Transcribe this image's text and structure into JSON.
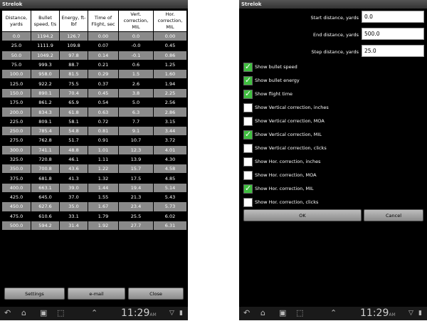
{
  "app_title": "Strelok",
  "table": {
    "headers": [
      "Distance, yards",
      "Bullet speed, f/s",
      "Energy, ft-lbf",
      "Time of Flight, sec",
      "Vert. correction, MIL",
      "Hor. correction, MIL"
    ],
    "rows": [
      [
        "0.0",
        "1194.2",
        "126.7",
        "0.00",
        "0.0",
        "0.00"
      ],
      [
        "25.0",
        "1111.9",
        "109.8",
        "0.07",
        "-0.0",
        "0.45"
      ],
      [
        "50.0",
        "1049.2",
        "97.8",
        "0.14",
        "-0.1",
        "0.86"
      ],
      [
        "75.0",
        "999.3",
        "88.7",
        "0.21",
        "0.6",
        "1.25"
      ],
      [
        "100.0",
        "958.0",
        "81.5",
        "0.29",
        "1.5",
        "1.60"
      ],
      [
        "125.0",
        "922.2",
        "75.5",
        "0.37",
        "2.6",
        "1.94"
      ],
      [
        "150.0",
        "890.1",
        "70.4",
        "0.45",
        "3.8",
        "2.25"
      ],
      [
        "175.0",
        "861.2",
        "65.9",
        "0.54",
        "5.0",
        "2.56"
      ],
      [
        "200.0",
        "834.3",
        "61.8",
        "0.63",
        "6.3",
        "2.86"
      ],
      [
        "225.0",
        "809.1",
        "58.1",
        "0.72",
        "7.7",
        "3.15"
      ],
      [
        "250.0",
        "785.4",
        "54.8",
        "0.81",
        "9.1",
        "3.44"
      ],
      [
        "275.0",
        "762.8",
        "51.7",
        "0.91",
        "10.7",
        "3.72"
      ],
      [
        "300.0",
        "741.1",
        "48.8",
        "1.01",
        "12.3",
        "4.01"
      ],
      [
        "325.0",
        "720.8",
        "46.1",
        "1.11",
        "13.9",
        "4.30"
      ],
      [
        "350.0",
        "700.8",
        "43.6",
        "1.22",
        "15.7",
        "4.58"
      ],
      [
        "375.0",
        "681.8",
        "41.3",
        "1.32",
        "17.5",
        "4.85"
      ],
      [
        "400.0",
        "663.1",
        "39.0",
        "1.44",
        "19.4",
        "5.14"
      ],
      [
        "425.0",
        "645.0",
        "37.0",
        "1.55",
        "21.3",
        "5.43"
      ],
      [
        "450.0",
        "627.6",
        "35.0",
        "1.67",
        "23.4",
        "5.73"
      ],
      [
        "475.0",
        "610.6",
        "33.1",
        "1.79",
        "25.5",
        "6.02"
      ],
      [
        "500.0",
        "594.2",
        "31.4",
        "1.92",
        "27.7",
        "6.31"
      ]
    ]
  },
  "left_buttons": {
    "settings": "Settings",
    "email": "e-mail",
    "close": "Close"
  },
  "status": {
    "time": "11:29",
    "suffix": "AM"
  },
  "settings": {
    "start_label": "Start distance, yards",
    "start_value": "0.0",
    "end_label": "End distance, yards",
    "end_value": "500.0",
    "step_label": "Step distance, yards",
    "step_value": "25.0",
    "options": [
      {
        "label": "Show bullet speed",
        "checked": true
      },
      {
        "label": "Show bullet energy",
        "checked": true
      },
      {
        "label": "Show flight time",
        "checked": true
      },
      {
        "label": "Show Vertical correction, inches",
        "checked": false
      },
      {
        "label": "Show Vertical correction, MOA",
        "checked": false
      },
      {
        "label": "Show Vertical correction, MIL",
        "checked": true
      },
      {
        "label": "Show Vertical correction, clicks",
        "checked": false
      },
      {
        "label": "Show Hor. correction, inches",
        "checked": false
      },
      {
        "label": "Show Hor. correction, MOA",
        "checked": false
      },
      {
        "label": "Show Hor. correction, MIL",
        "checked": true
      },
      {
        "label": "Show Hor. correction, clicks",
        "checked": false
      }
    ],
    "ok_label": "OK",
    "cancel_label": "Cancel"
  },
  "colors": {
    "checkbox_checked": "#3fbf3f",
    "row_alt": "#8a8a8a",
    "background": "#000000"
  }
}
